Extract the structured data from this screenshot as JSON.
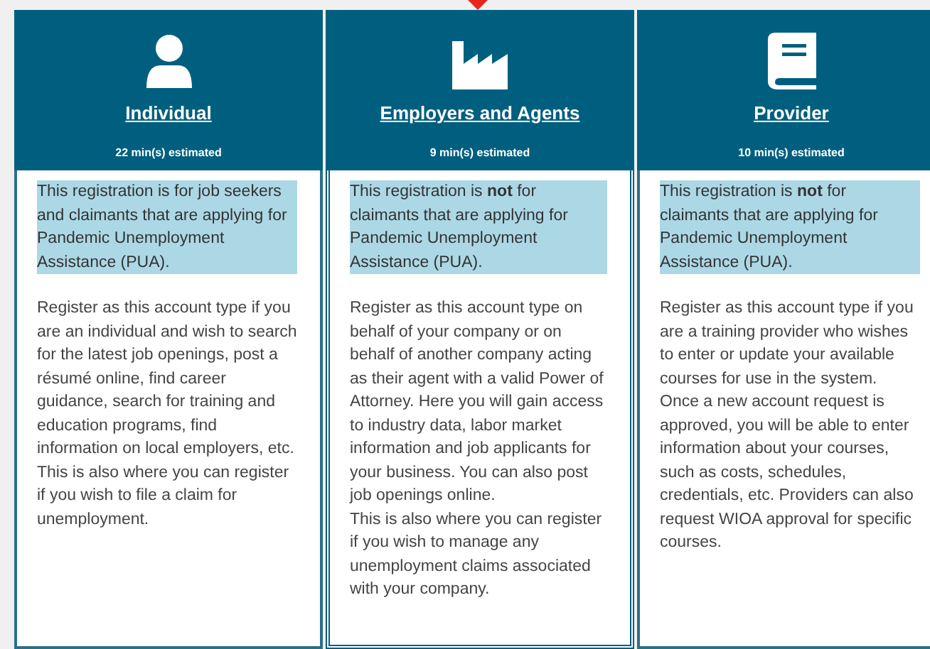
{
  "cards": [
    {
      "title": "Individual",
      "selected": false,
      "estimate": "22 min(s) estimated",
      "notice": "This registration is for job seekers and claimants that are applying for Pandemic Unemployment Assistance (PUA).",
      "paragraphs": [
        "Register as this account type if you are an individual and wish to search for the latest job openings, post a résumé online, find career guidance, search for training and education programs, find information on local employers, etc. This is also where you can register if you wish to file a claim for unemployment."
      ]
    },
    {
      "title": "Employers and Agents",
      "selected": true,
      "estimate": "9 min(s) estimated",
      "notice": "This registration is **not** for claimants that are applying for Pandemic Unemployment Assistance (PUA).",
      "paragraphs": [
        "Register as this account type on behalf of your company or on behalf of another company acting as their agent with a valid Power of Attorney. Here you will gain access to industry data, labor market information and job applicants for your business. You can also post job openings online.",
        "This is also where you can register if you wish to manage any unemployment claims associated with your company."
      ]
    },
    {
      "title": "Provider",
      "selected": false,
      "estimate": "10 min(s) estimated",
      "notice": "This registration is **not** for claimants that are applying for Pandemic Unemployment Assistance (PUA).",
      "paragraphs": [
        "Register as this account type if you are a training provider who wishes to enter or update your available courses for use in the system. Once a new account request is approved, you will be able to enter information about your courses, such as costs, schedules, credentials, etc. Providers can also request WIOA approval for specific courses."
      ]
    }
  ]
}
